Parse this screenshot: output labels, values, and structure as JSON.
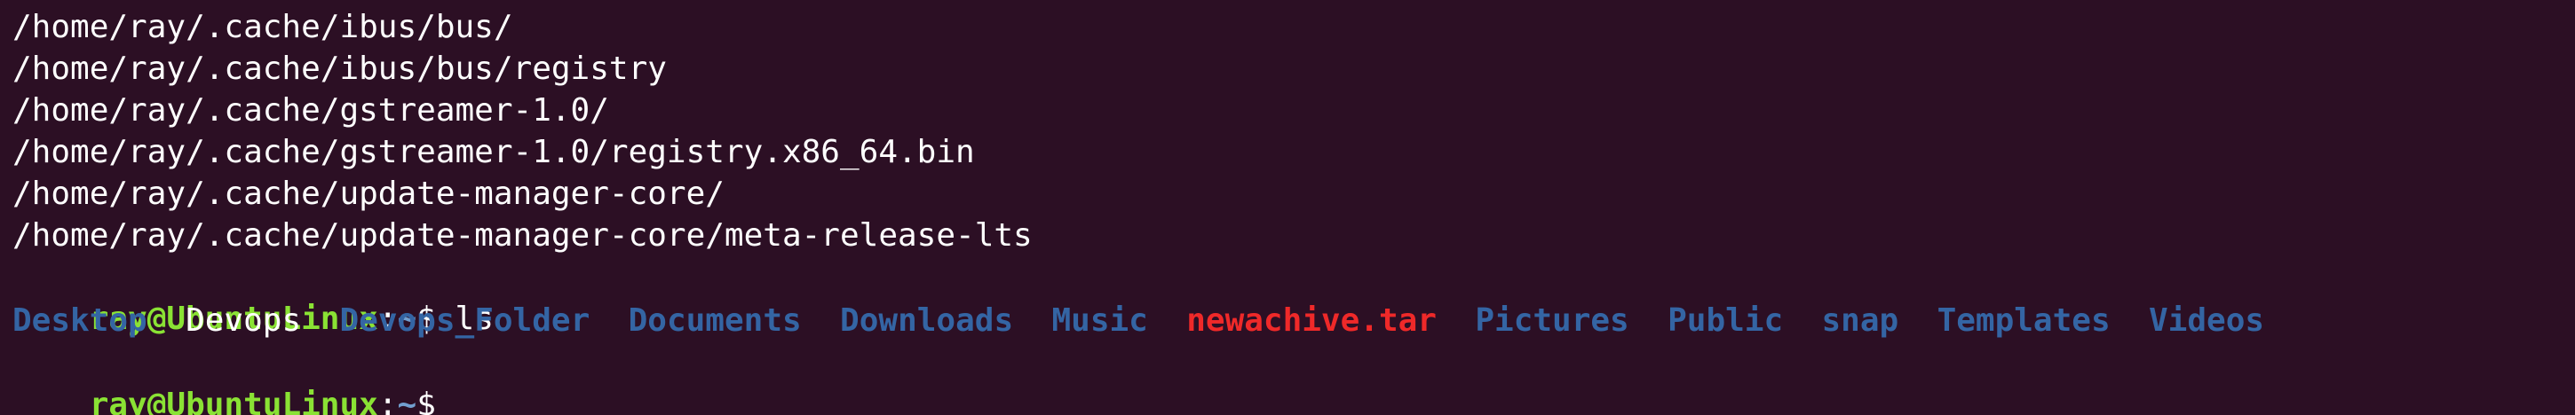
{
  "output_lines": [
    "/home/ray/.cache/ibus/bus/",
    "/home/ray/.cache/ibus/bus/registry",
    "/home/ray/.cache/gstreamer-1.0/",
    "/home/ray/.cache/gstreamer-1.0/registry.x86_64.bin",
    "/home/ray/.cache/update-manager-core/",
    "/home/ray/.cache/update-manager-core/meta-release-lts"
  ],
  "prompt": {
    "user_host": "ray@UbuntuLinux",
    "separator": ":",
    "path": "~",
    "symbol": "$"
  },
  "command": " ls",
  "ls_entries": [
    {
      "name": "Desktop",
      "type": "dir"
    },
    {
      "name": "Devops",
      "type": "file"
    },
    {
      "name": "Devops_Folder",
      "type": "dir"
    },
    {
      "name": "Documents",
      "type": "dir"
    },
    {
      "name": "Downloads",
      "type": "dir"
    },
    {
      "name": "Music",
      "type": "dir"
    },
    {
      "name": "newachive.tar",
      "type": "archive"
    },
    {
      "name": "Pictures",
      "type": "dir"
    },
    {
      "name": "Public",
      "type": "dir"
    },
    {
      "name": "snap",
      "type": "dir"
    },
    {
      "name": "Templates",
      "type": "dir"
    },
    {
      "name": "Videos",
      "type": "dir"
    }
  ],
  "colors": {
    "background": "#2c0f24",
    "prompt_user": "#8ae234",
    "prompt_path": "#729fcf",
    "directory": "#3465a4",
    "archive": "#ef2929",
    "text": "#ffffff"
  }
}
